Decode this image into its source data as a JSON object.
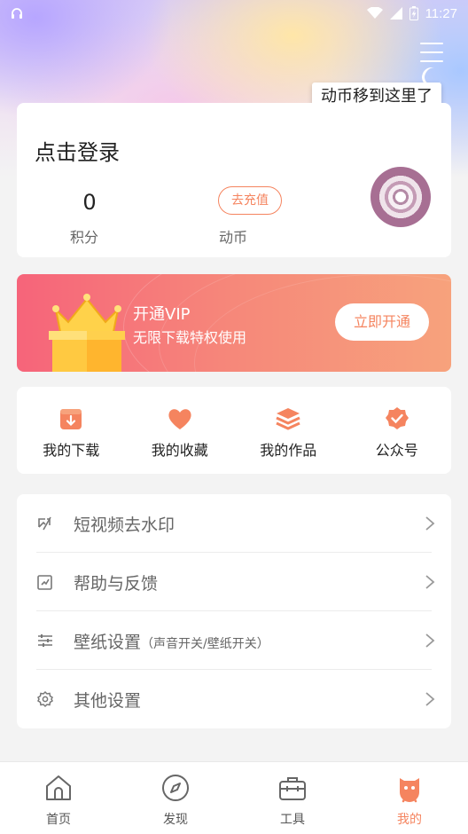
{
  "status_bar": {
    "time": "11:27",
    "icons": [
      "headset-icon",
      "wifi-icon",
      "signal-icon",
      "battery-charging-icon"
    ]
  },
  "header": {
    "menu_icon": "hamburger-menu-icon",
    "tooltip": "动币移到这里了"
  },
  "login_card": {
    "title": "点击登录",
    "points_value": "0",
    "points_label": "积分",
    "recharge_label": "去充值",
    "coins_label": "动币"
  },
  "vip": {
    "title": "开通VIP",
    "subtitle": "无限下载特权使用",
    "button": "立即开通"
  },
  "shortcuts": [
    {
      "label": "我的下载",
      "icon": "download-box-icon"
    },
    {
      "label": "我的收藏",
      "icon": "heart-icon"
    },
    {
      "label": "我的作品",
      "icon": "layers-icon"
    },
    {
      "label": "公众号",
      "icon": "verified-badge-icon"
    }
  ],
  "settings": [
    {
      "label": "短视频去水印",
      "note": "",
      "icon": "watermark-remove-icon"
    },
    {
      "label": "帮助与反馈",
      "note": "",
      "icon": "feedback-icon"
    },
    {
      "label": "壁纸设置",
      "note": "（声音开关/壁纸开关）",
      "icon": "sliders-icon"
    },
    {
      "label": "其他设置",
      "note": "",
      "icon": "gear-icon"
    }
  ],
  "tabs": [
    {
      "label": "首页",
      "icon": "home-icon",
      "active": false
    },
    {
      "label": "发现",
      "icon": "compass-icon",
      "active": false
    },
    {
      "label": "工具",
      "icon": "toolbox-icon",
      "active": false
    },
    {
      "label": "我的",
      "icon": "profile-mascot-icon",
      "active": true
    }
  ],
  "colors": {
    "accent": "#f5845f",
    "vip_gradient_start": "#f6647a",
    "vip_gradient_end": "#f7a27c",
    "background": "#f3f3f3"
  }
}
